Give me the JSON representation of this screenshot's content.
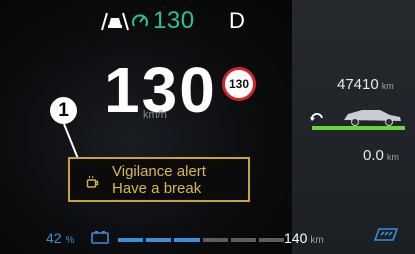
{
  "header": {
    "set_speed": "130",
    "gear": "D"
  },
  "speed": {
    "value": "130",
    "unit": "km/h",
    "limit_sign": "130"
  },
  "callout": {
    "number": "1"
  },
  "alert": {
    "title": "Vigilance alert",
    "subtitle": "Have a break",
    "icon": "coffee-cup-icon"
  },
  "fuel": {
    "percent": "42",
    "percent_unit": "%",
    "level": 0.42,
    "range": "140",
    "range_unit": "km"
  },
  "trip_panel": {
    "odometer": "47410",
    "odometer_unit": "km",
    "trip": "0.0",
    "trip_unit": "km"
  },
  "colors": {
    "set_speed": "#2bc28f",
    "alert": "#d9b84e",
    "fuel": "#3b8fd9",
    "trip_bar": "#6fd43c",
    "limit_ring": "#d0262b"
  }
}
